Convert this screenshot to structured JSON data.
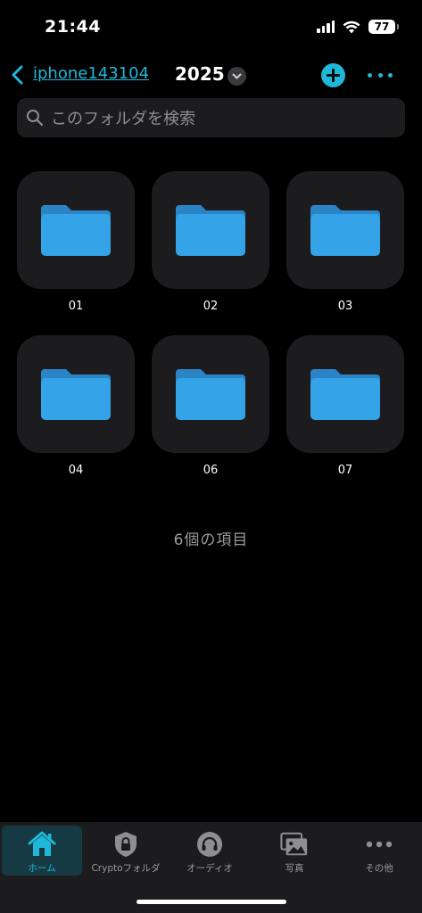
{
  "status_bar": {
    "time": "21:44",
    "battery": "77"
  },
  "nav": {
    "back_label": "iphone143104",
    "title": "2025",
    "icons": {
      "back": "chevron-left-icon",
      "dropdown": "chevron-down-icon",
      "add": "plus-circle-icon",
      "more": "more-dots-icon"
    }
  },
  "search": {
    "placeholder": "このフォルダを検索"
  },
  "folders": [
    {
      "label": "01"
    },
    {
      "label": "02"
    },
    {
      "label": "03"
    },
    {
      "label": "04"
    },
    {
      "label": "06"
    },
    {
      "label": "07"
    }
  ],
  "item_count": "6個の項目",
  "tabs": [
    {
      "label": "ホーム",
      "icon": "home-icon",
      "active": true
    },
    {
      "label": "Cryptoフォルダ",
      "icon": "lock-shield-icon",
      "active": false
    },
    {
      "label": "オーディオ",
      "icon": "headphones-icon",
      "active": false
    },
    {
      "label": "写真",
      "icon": "photos-icon",
      "active": false
    },
    {
      "label": "その他",
      "icon": "more-dots-icon",
      "active": false
    }
  ],
  "colors": {
    "accent": "#1fb8d8",
    "folder": "#2f9ae0",
    "tile": "#1c1c1e"
  }
}
